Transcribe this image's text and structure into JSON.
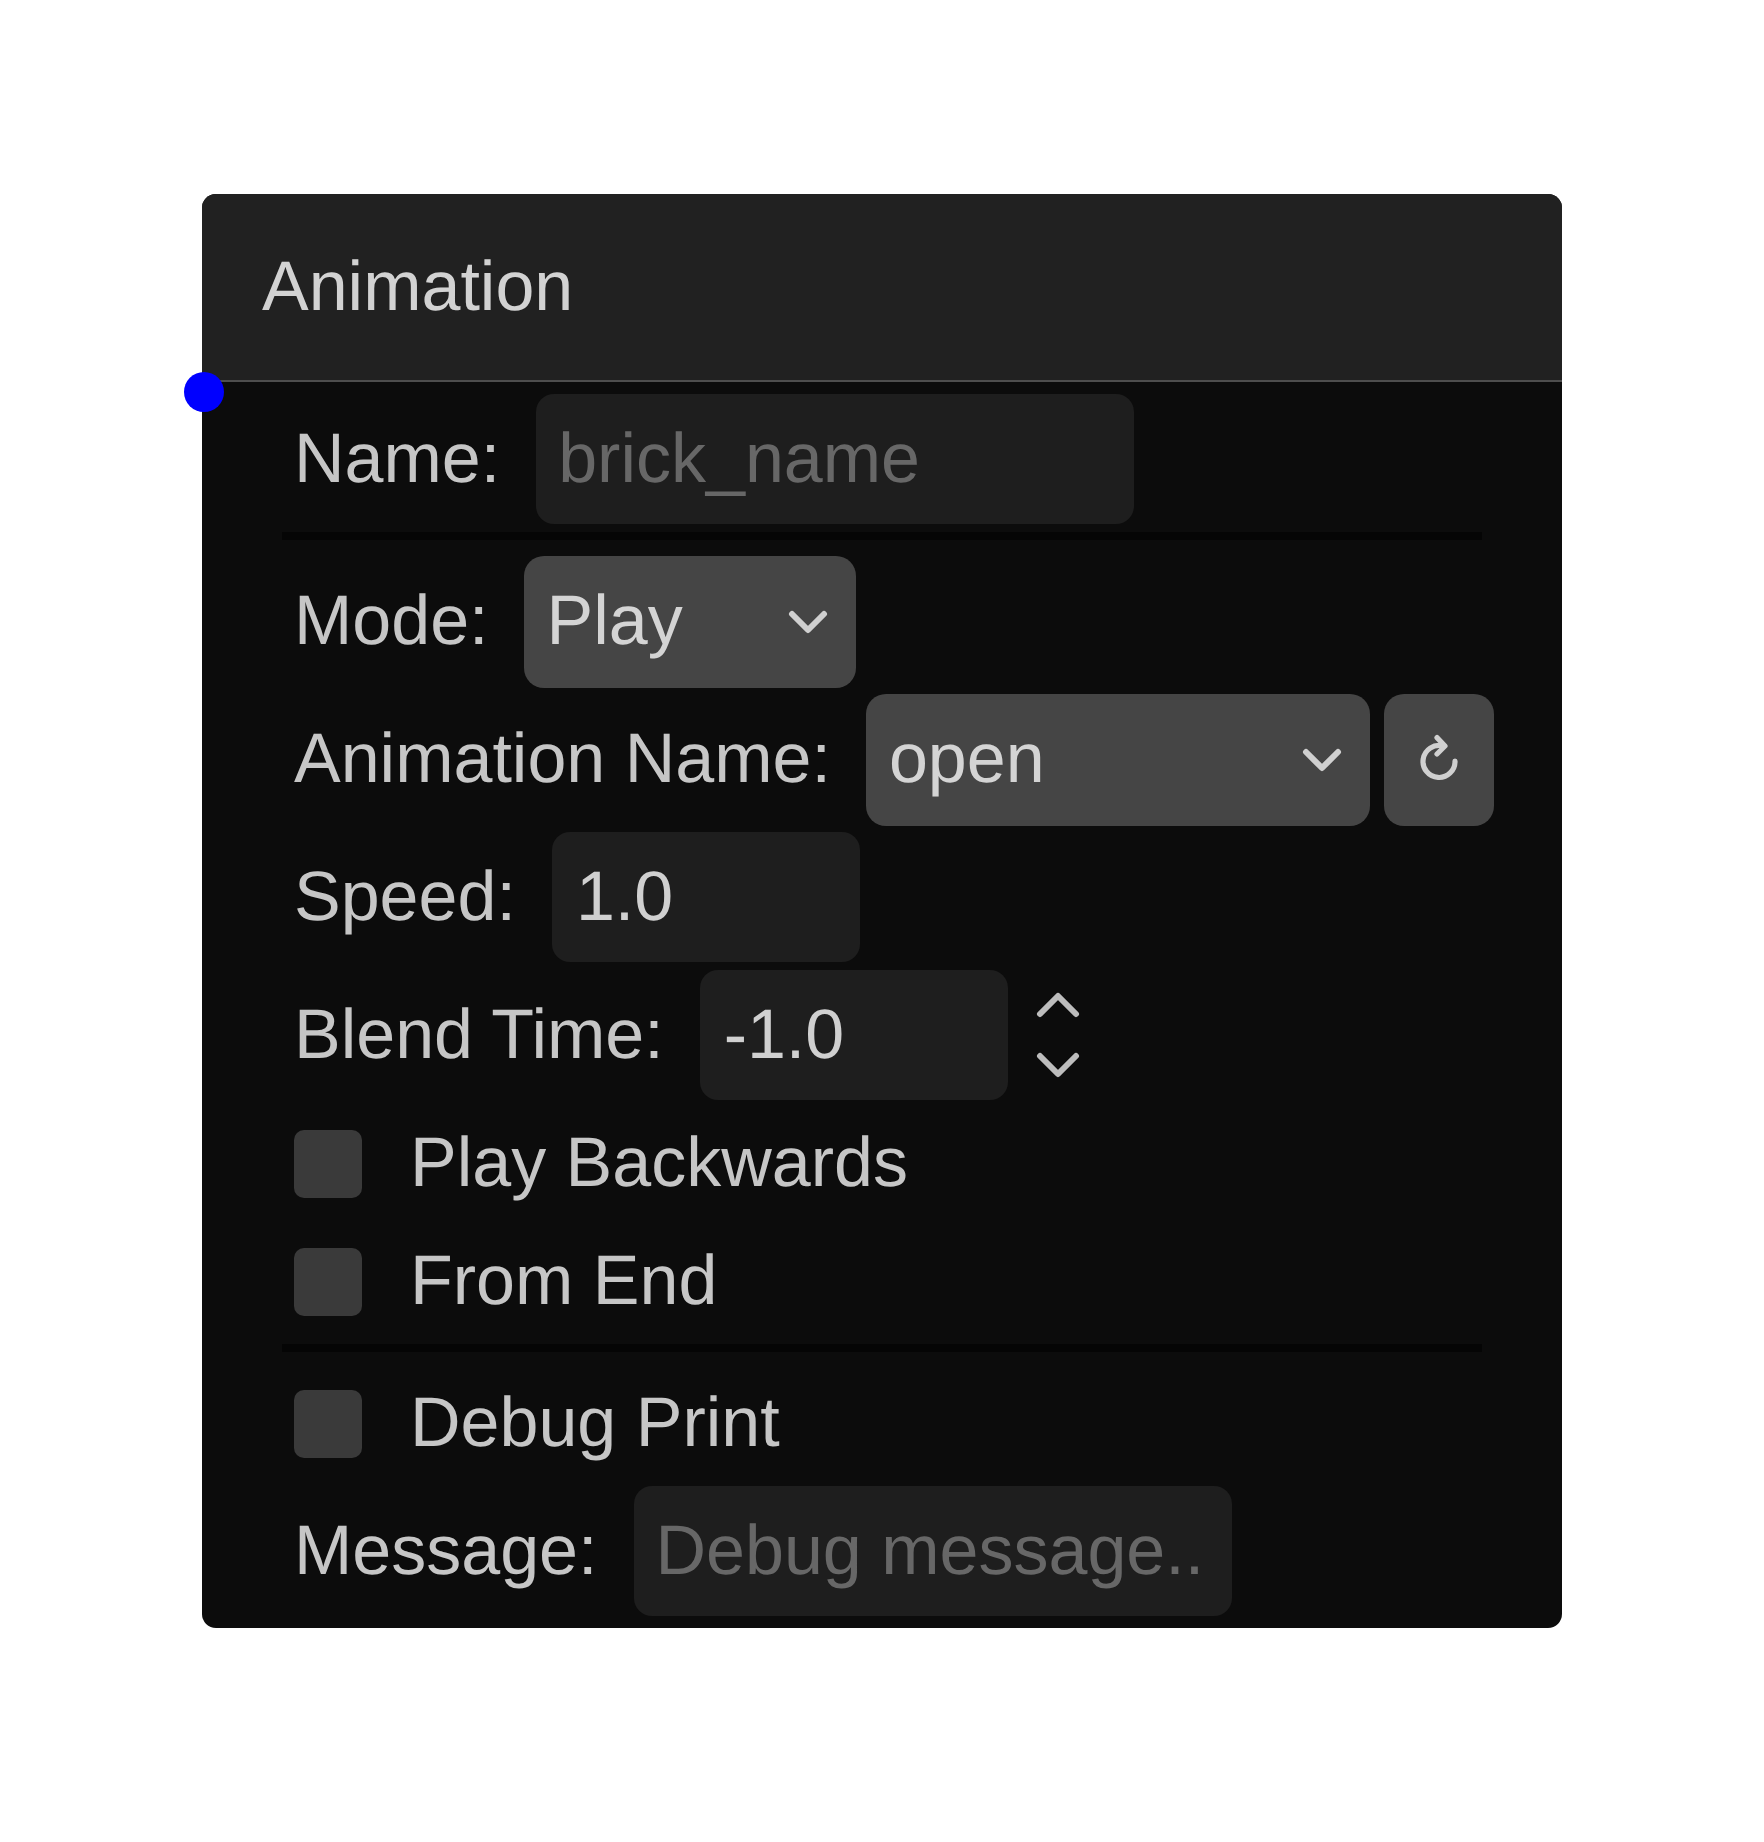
{
  "node": {
    "title": "Animation"
  },
  "rows": [
    {
      "kind": "text",
      "label": "Name:",
      "placeholder": "brick_name"
    },
    {
      "kind": "divider"
    },
    {
      "kind": "select",
      "label": "Mode:",
      "value": "Play",
      "refresh": false
    },
    {
      "kind": "select",
      "label": "Animation Name:",
      "value": "open",
      "refresh": true
    },
    {
      "kind": "number",
      "label": "Speed:",
      "value": "1.0",
      "spinner": false
    },
    {
      "kind": "number",
      "label": "Blend Time:",
      "value": "-1.0",
      "spinner": true
    },
    {
      "kind": "checkbox",
      "label": "Play Backwards",
      "checked": false
    },
    {
      "kind": "checkbox",
      "label": "From End",
      "checked": false
    },
    {
      "kind": "divider"
    },
    {
      "kind": "checkbox",
      "label": "Debug Print",
      "checked": false
    },
    {
      "kind": "text",
      "label": "Message:",
      "placeholder": "Debug message.."
    }
  ]
}
